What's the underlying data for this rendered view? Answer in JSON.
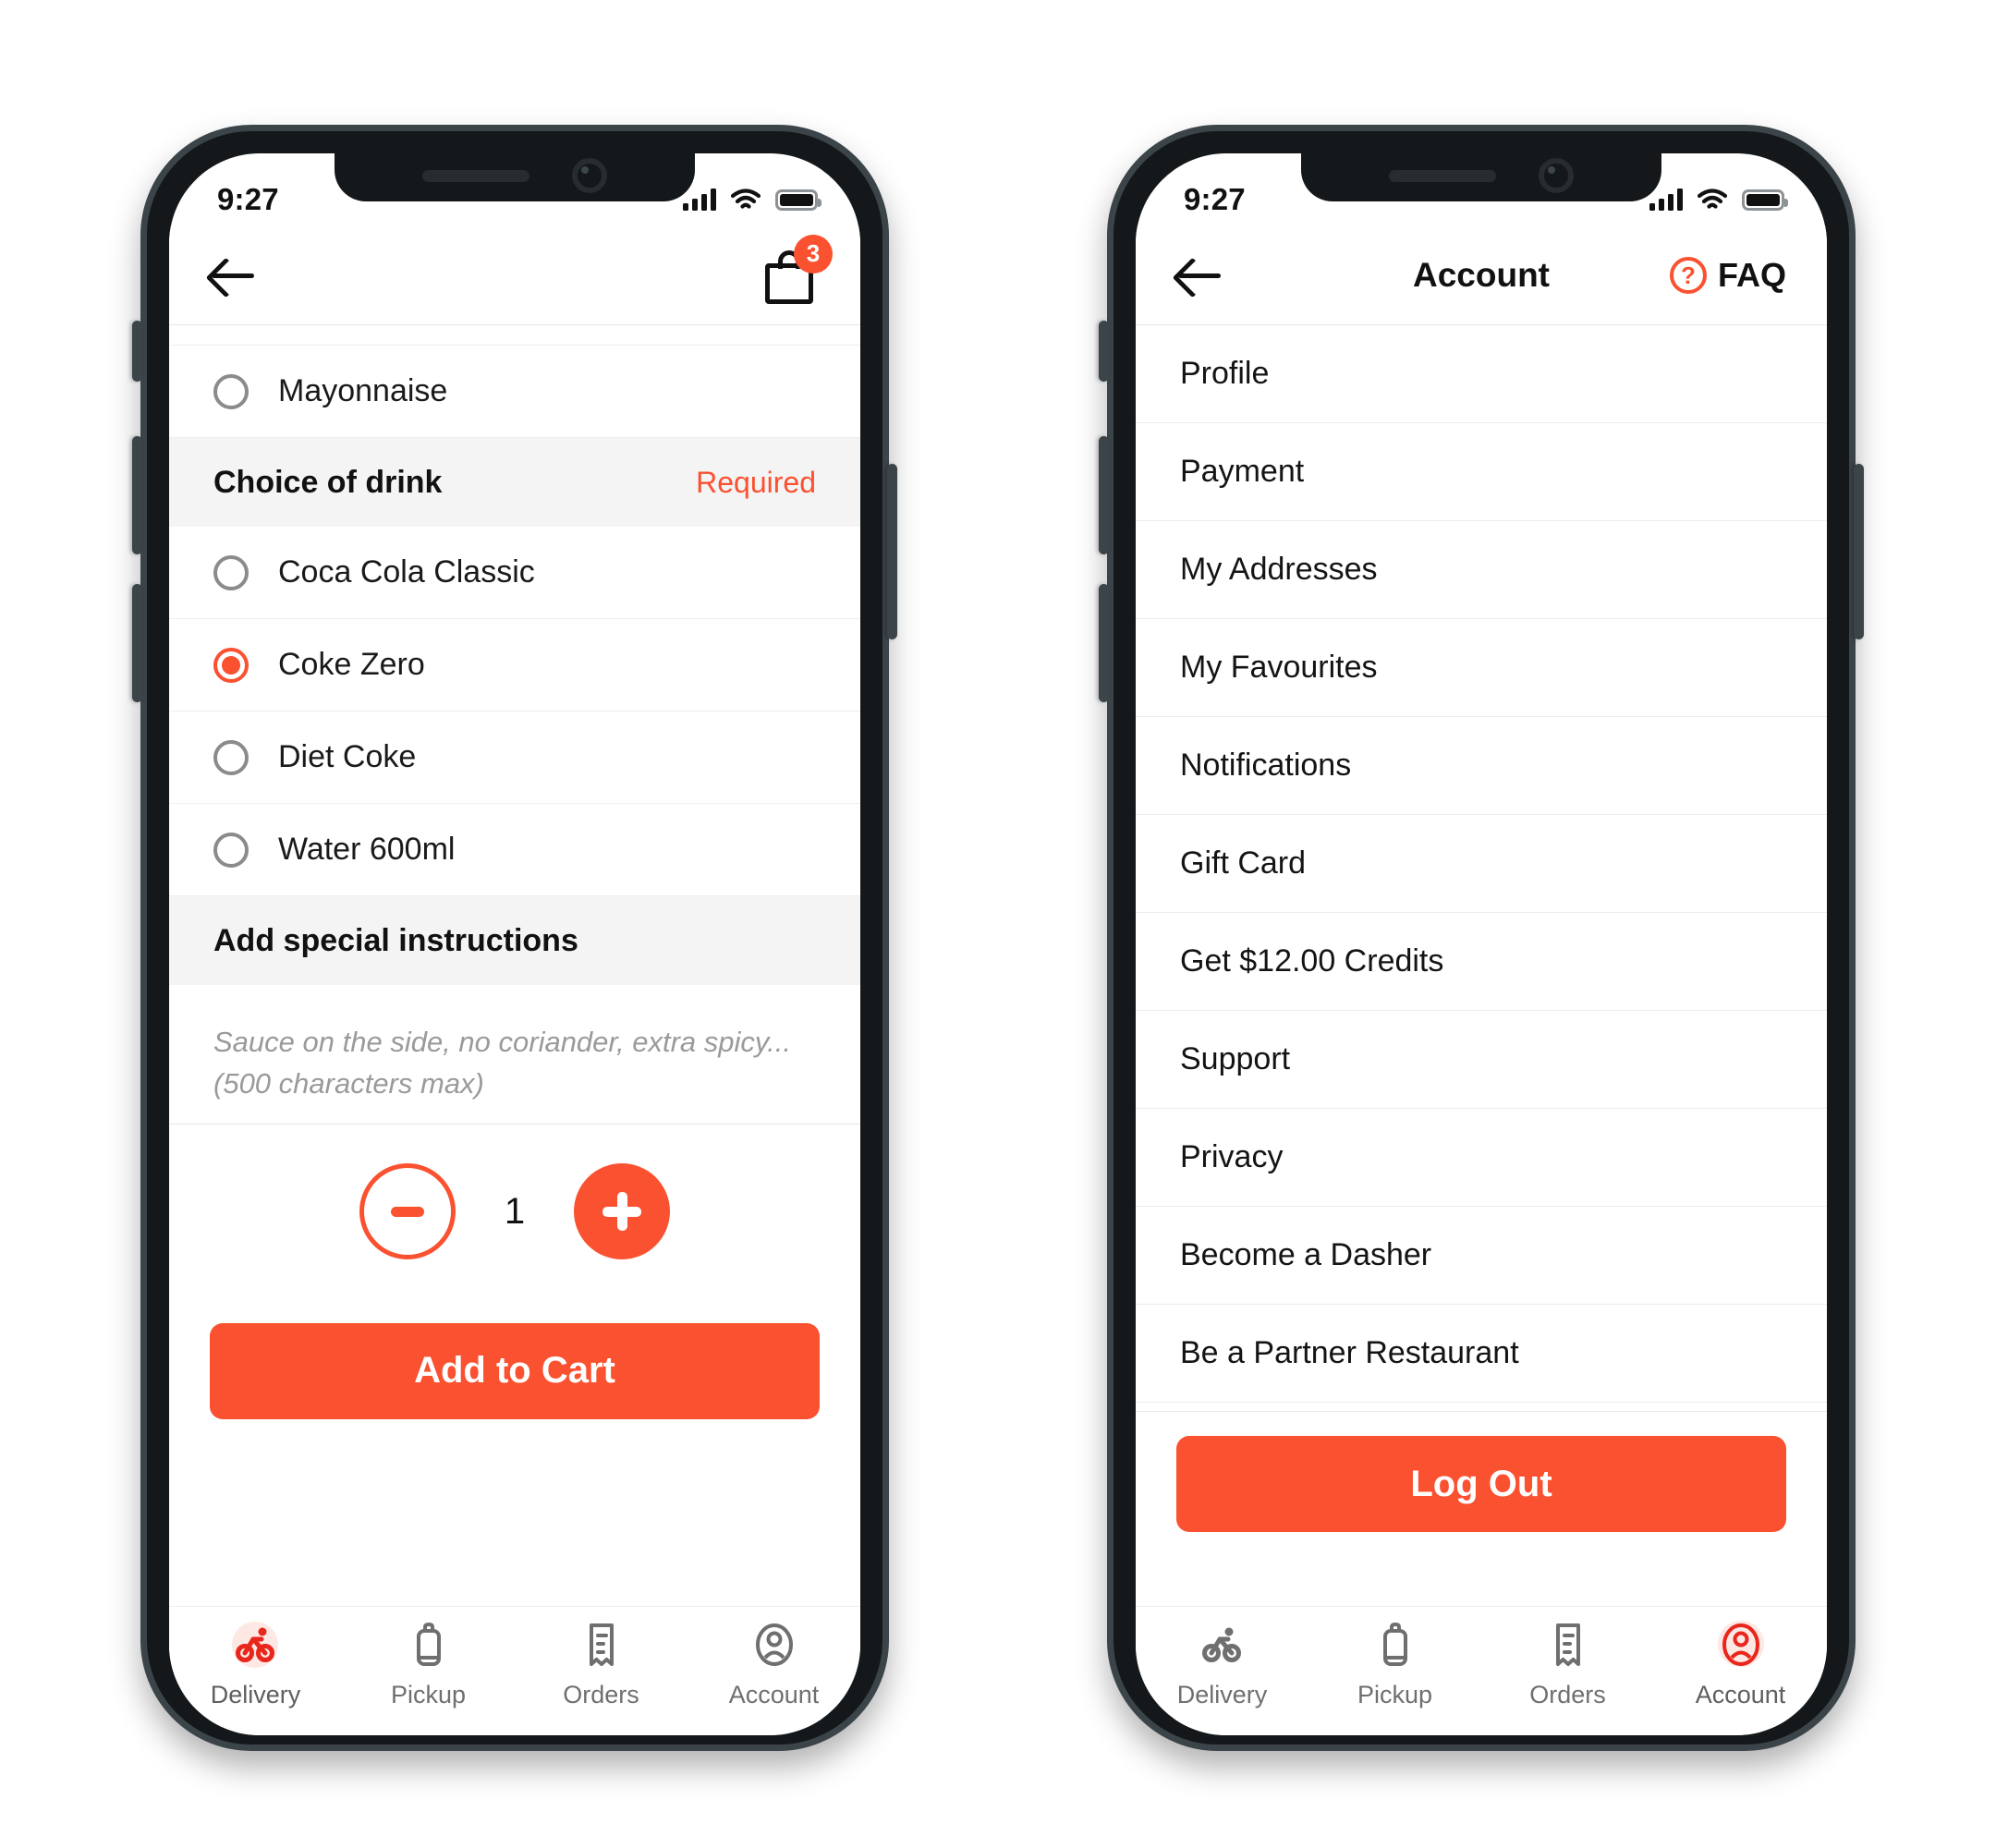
{
  "accent": "#FA5130",
  "phone_left": {
    "status": {
      "time": "9:27",
      "signal_icon": "signal-bars-icon",
      "wifi_icon": "wifi-icon",
      "battery_icon": "battery-full-icon"
    },
    "header": {
      "back_icon": "back-arrow-icon",
      "cart_icon": "shopping-bag-icon",
      "cart_badge": "3"
    },
    "clipped_option": {
      "label": ""
    },
    "sauce_options": [
      {
        "label": "Mayonnaise",
        "selected": false
      }
    ],
    "drink_section": {
      "title": "Choice of drink",
      "required_label": "Required"
    },
    "drink_options": [
      {
        "label": "Coca Cola Classic",
        "selected": false
      },
      {
        "label": "Coke Zero",
        "selected": true
      },
      {
        "label": "Diet Coke",
        "selected": false
      },
      {
        "label": "Water 600ml",
        "selected": false
      }
    ],
    "instructions": {
      "title": "Add special instructions",
      "placeholder": "Sauce on the side, no coriander, extra spicy... (500 characters max)",
      "value": ""
    },
    "stepper": {
      "minus_label": "-",
      "quantity": "1",
      "plus_label": "+"
    },
    "cta": {
      "label": "Add to Cart"
    },
    "tabs": [
      {
        "label": "Delivery",
        "icon": "cyclist-icon",
        "active": true
      },
      {
        "label": "Pickup",
        "icon": "bag-icon",
        "active": false
      },
      {
        "label": "Orders",
        "icon": "receipt-icon",
        "active": false
      },
      {
        "label": "Account",
        "icon": "user-circle-icon",
        "active": false
      }
    ]
  },
  "phone_right": {
    "status": {
      "time": "9:27",
      "signal_icon": "signal-bars-icon",
      "wifi_icon": "wifi-icon",
      "battery_icon": "battery-full-icon"
    },
    "header": {
      "back_icon": "back-arrow-icon",
      "title": "Account",
      "faq_icon": "question-circle-icon",
      "faq_label": "FAQ"
    },
    "menu_items": [
      {
        "label": "Profile"
      },
      {
        "label": "Payment"
      },
      {
        "label": "My Addresses"
      },
      {
        "label": "My Favourites"
      },
      {
        "label": "Notifications"
      },
      {
        "label": "Gift Card"
      },
      {
        "label": "Get $12.00 Credits"
      },
      {
        "label": "Support"
      },
      {
        "label": "Privacy"
      },
      {
        "label": "Become a Dasher"
      },
      {
        "label": "Be a Partner Restaurant"
      }
    ],
    "cta": {
      "label": "Log Out"
    },
    "tabs": [
      {
        "label": "Delivery",
        "icon": "cyclist-icon",
        "active": false
      },
      {
        "label": "Pickup",
        "icon": "bag-icon",
        "active": false
      },
      {
        "label": "Orders",
        "icon": "receipt-icon",
        "active": false
      },
      {
        "label": "Account",
        "icon": "user-circle-icon",
        "active": true
      }
    ]
  }
}
